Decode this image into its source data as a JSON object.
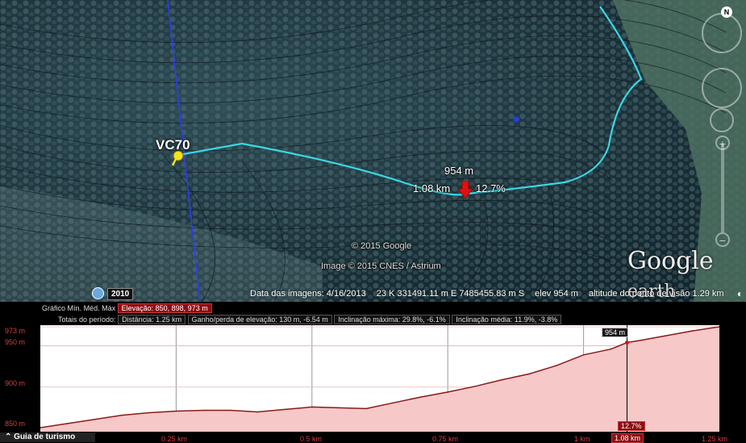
{
  "map": {
    "placemark_label": "VC70",
    "cursor_elevation": "954 m",
    "cursor_distance": "1.08 km",
    "cursor_slope": "12.7%",
    "copyright": "© 2015 Google",
    "imagery_credit": "Image © 2015 CNES / Astrium",
    "logo_main": "Google",
    "logo_sub": "earth",
    "historical_year": "2010",
    "north_label": "N",
    "status": {
      "imagery_date": "Data das imagens: 4/16/2013",
      "coordinates": "23 K 331491.11 m E 7485455.83 m S",
      "elevation": "elev  954 m",
      "eye_altitude": "altitude do ponto de visão  1.29 km"
    },
    "colors": {
      "path": "#38d8e6",
      "placemark": "#f5e11e",
      "cursor_arrow": "#e01010",
      "boundary_line": "#2a3cff"
    },
    "icons": {
      "placemark": "pushpin-icon",
      "cursor": "down-arrow-icon",
      "clock": "clock-icon",
      "compass": "compass-icon"
    }
  },
  "profile": {
    "graph_label": "Gráfico",
    "min_label": "Mín.",
    "avg_label": "Méd.",
    "max_label": "Máx",
    "elevation_summary": "Elevação: 850, 898, 973 m",
    "totals_label": "Totais do período:",
    "distance": "Distância: 1.25 km",
    "gain_loss": "Ganho/perda de elevação: 130 m, -6.54 m",
    "max_slope": "Inclinação máxima: 29.8%, -6.1%",
    "avg_slope": "Inclinação média: 11.9%, -3.8%",
    "tour_button": "Guia de turismo",
    "cursor_elev": "954 m",
    "cursor_slope": "12.7%",
    "cursor_dist": "1.08 km"
  },
  "chart_data": {
    "type": "area",
    "x_unit": "km",
    "y_unit": "m",
    "xlim": [
      0,
      1.25
    ],
    "ylim": [
      850,
      973
    ],
    "y_ticks": [
      "973 m",
      "950 m",
      "900 m",
      "850 m"
    ],
    "x_ticks": [
      "0.25 km",
      "0.5 km",
      "0.75 km",
      "1 km",
      "1.25 km"
    ],
    "x": [
      0,
      0.05,
      0.1,
      0.15,
      0.2,
      0.25,
      0.3,
      0.35,
      0.4,
      0.45,
      0.5,
      0.55,
      0.6,
      0.65,
      0.7,
      0.75,
      0.8,
      0.85,
      0.9,
      0.95,
      1.0,
      1.05,
      1.08,
      1.1,
      1.15,
      1.2,
      1.25
    ],
    "values": [
      851,
      856,
      861,
      866,
      869,
      871,
      872,
      872,
      870,
      873,
      876,
      875,
      874,
      881,
      888,
      894,
      901,
      909,
      916,
      926,
      939,
      946,
      954,
      956,
      962,
      968,
      973
    ],
    "cursor_x": 1.08,
    "cursor_y": 954,
    "line_color": "#8b1a1a",
    "fill_color": "#f7c8c8"
  }
}
